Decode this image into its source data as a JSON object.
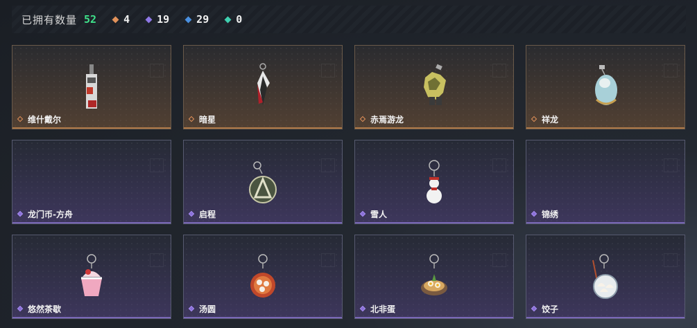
{
  "header": {
    "label": "已拥有数量",
    "total": "52",
    "stats": [
      {
        "value": "4",
        "color": "#e2925a",
        "icon": "orange-rarity-icon"
      },
      {
        "value": "19",
        "color": "#8e78e6",
        "icon": "purple-rarity-icon"
      },
      {
        "value": "29",
        "color": "#4a90e0",
        "icon": "blue-rarity-icon"
      },
      {
        "value": "0",
        "color": "#3fd0b0",
        "icon": "green-rarity-icon"
      }
    ]
  },
  "items": [
    {
      "name": "维什戴尔",
      "rarity": "orange"
    },
    {
      "name": "暗星",
      "rarity": "orange"
    },
    {
      "name": "赤焉游龙",
      "rarity": "orange"
    },
    {
      "name": "祥龙",
      "rarity": "orange"
    },
    {
      "name": "龙门币-方舟",
      "rarity": "purple"
    },
    {
      "name": "启程",
      "rarity": "purple"
    },
    {
      "name": "雪人",
      "rarity": "purple"
    },
    {
      "name": "锦绣",
      "rarity": "purple"
    },
    {
      "name": "悠然茶歇",
      "rarity": "purple"
    },
    {
      "name": "汤圆",
      "rarity": "purple"
    },
    {
      "name": "北非蛋",
      "rarity": "purple"
    },
    {
      "name": "饺子",
      "rarity": "purple"
    }
  ]
}
